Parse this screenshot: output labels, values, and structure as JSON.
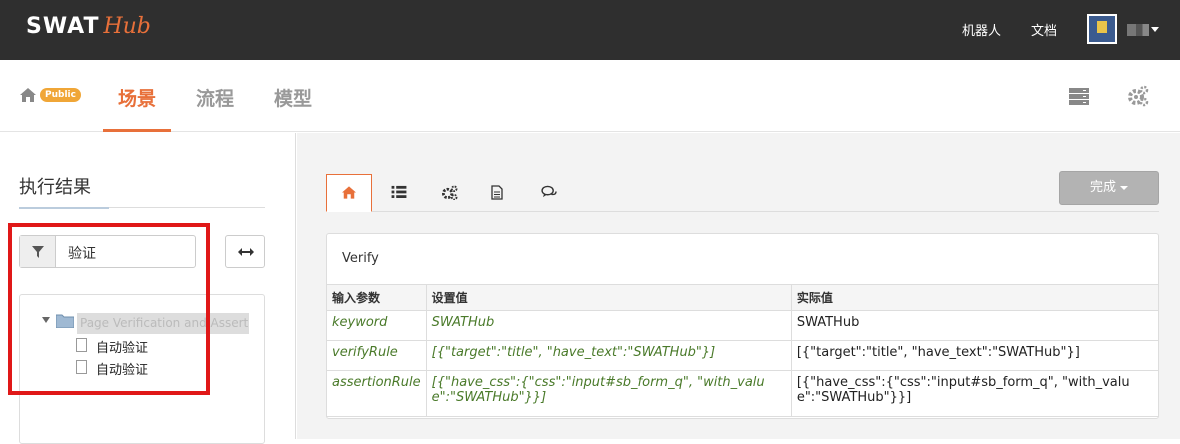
{
  "topbar": {
    "logo_main": "SWAT",
    "logo_sub": "Hub",
    "nav_robot": "机器人",
    "nav_docs": "文档"
  },
  "subbar": {
    "public_badge": "Public",
    "tabs": [
      {
        "label": "场景",
        "active": true
      },
      {
        "label": "流程",
        "active": false
      },
      {
        "label": "模型",
        "active": false
      }
    ]
  },
  "left": {
    "title": "执行结果",
    "filter_value": "验证",
    "tree": {
      "root_label": "Page Verification and Assertion",
      "children": [
        "自动验证",
        "自动验证"
      ]
    }
  },
  "main": {
    "done_label": "完成",
    "panel_title": "Verify",
    "table": {
      "headers": [
        "输入参数",
        "设置值",
        "实际值"
      ],
      "rows": [
        {
          "name": "keyword",
          "set": "SWATHub",
          "actual": "SWATHub"
        },
        {
          "name": "verifyRule",
          "set": "[{\"target\":\"title\", \"have_text\":\"SWATHub\"}]",
          "actual": "[{\"target\":\"title\", \"have_text\":\"SWATHub\"}]"
        },
        {
          "name": "assertionRule",
          "set": "[{\"have_css\":{\"css\":\"input#sb_form_q\", \"with_value\":\"SWATHub\"}}]",
          "actual": "[{\"have_css\":{\"css\":\"input#sb_form_q\", \"with_value\":\"SWATHub\"}}]"
        }
      ]
    }
  },
  "colors": {
    "accent": "#e8703a",
    "topbar_bg": "#2f2f2f",
    "highlight_red": "#e01818",
    "param_green": "#4a7a2a"
  },
  "icons": [
    "home-icon",
    "server-icon",
    "settings-gears-icon",
    "list-icon",
    "cogs-icon",
    "document-icon",
    "comments-icon",
    "filter-icon",
    "expand-horizontal-icon",
    "folder-icon",
    "file-icon"
  ]
}
